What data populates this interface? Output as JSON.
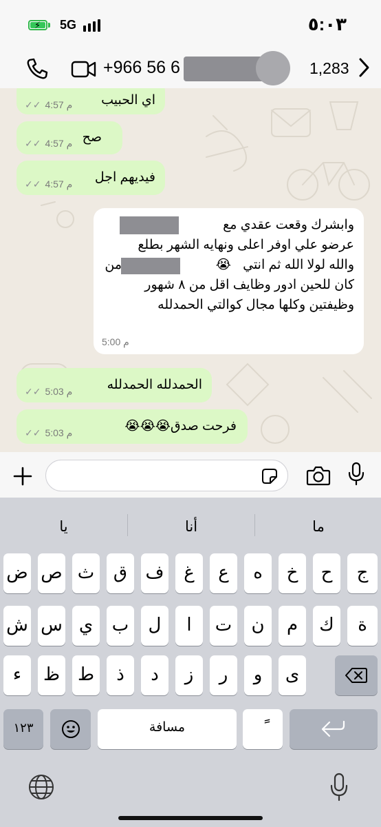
{
  "status_bar": {
    "network": "5G",
    "time": "٥:٠٣"
  },
  "header": {
    "phone_number": "+966 56 6",
    "unread_count": "1,283"
  },
  "messages": [
    {
      "text": "اي الحبيب",
      "time": "4:57 م",
      "direction": "outgoing"
    },
    {
      "text": "صح",
      "time": "4:57 م",
      "direction": "outgoing"
    },
    {
      "text": "فيديهم اجل",
      "time": "4:57 م",
      "direction": "outgoing"
    },
    {
      "lines": [
        "وابشرك وقعت عقدي مع",
        "عرضو علي اوفر اعلى  ونهايه الشهر بطلع",
        "من",
        "والله لولا الله ثم انتي",
        "كان للحين ادور وظايف اقل من ٨ شهور",
        "وظيفتين وكلها مجال كوالتي الحمدلله"
      ],
      "emoji": "😭",
      "time": "5:00 م",
      "direction": "incoming"
    },
    {
      "text": "الحمدلله الحمدلله",
      "time": "5:03 م",
      "direction": "outgoing"
    },
    {
      "text": "فرحت صدق",
      "emoji": "😭😭😭",
      "time": "5:03 م",
      "direction": "outgoing"
    }
  ],
  "keyboard": {
    "suggestions": [
      "ما",
      "أنا",
      "يا"
    ],
    "row1": [
      "ض",
      "ص",
      "ث",
      "ق",
      "ف",
      "غ",
      "ع",
      "ه",
      "خ",
      "ح",
      "ج"
    ],
    "row2": [
      "ش",
      "س",
      "ي",
      "ب",
      "ل",
      "ا",
      "ت",
      "ن",
      "م",
      "ك",
      "ة"
    ],
    "row3": [
      "ء",
      "ظ",
      "ط",
      "ذ",
      "د",
      "ز",
      "ر",
      "و",
      "ى"
    ],
    "numbers_key": "١٢٣",
    "space_key": "مسافة",
    "diacritic_key": "ً"
  },
  "colors": {
    "outgoing_bubble": "#dcf8c6",
    "incoming_bubble": "#ffffff",
    "chat_background": "#efeae2",
    "battery": "#34c759"
  },
  "icons": [
    "phone-icon",
    "video-call-icon",
    "back-chevron-icon",
    "plus-icon",
    "sticker-icon",
    "camera-icon",
    "microphone-icon",
    "emoji-icon",
    "globe-icon",
    "dictation-icon",
    "backspace-icon",
    "return-icon"
  ]
}
